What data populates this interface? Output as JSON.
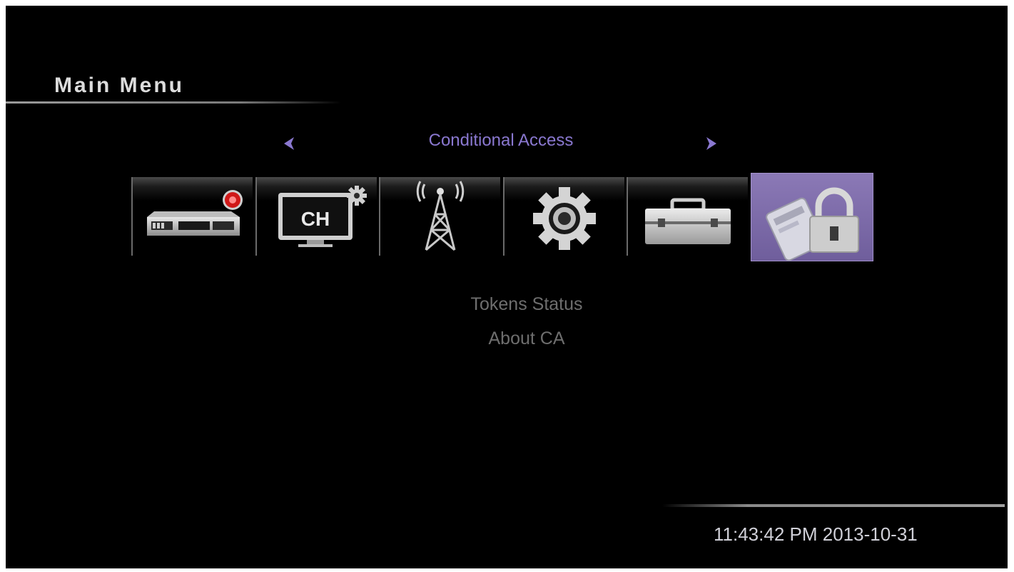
{
  "header": {
    "title": "Main Menu"
  },
  "category": {
    "current": "Conditional Access",
    "prev_icon": "chevron-left-icon",
    "next_icon": "chevron-right-icon"
  },
  "menu_tiles": [
    {
      "icon": "set-top-box-icon",
      "selected": false
    },
    {
      "icon": "channel-settings-icon",
      "tv_label": "CH",
      "selected": false
    },
    {
      "icon": "antenna-tower-icon",
      "selected": false
    },
    {
      "icon": "gear-icon",
      "selected": false
    },
    {
      "icon": "toolbox-icon",
      "selected": false
    },
    {
      "icon": "card-lock-icon",
      "selected": true
    }
  ],
  "submenu": {
    "items": [
      "Tokens Status",
      "About CA"
    ]
  },
  "status": {
    "time": "11:43:42 PM",
    "date": "2013-10-31"
  },
  "colors": {
    "background": "#000000",
    "accent": "#8a78d0",
    "selected_tile": "#7a68a8",
    "submenu_text": "#6e6e6e"
  }
}
